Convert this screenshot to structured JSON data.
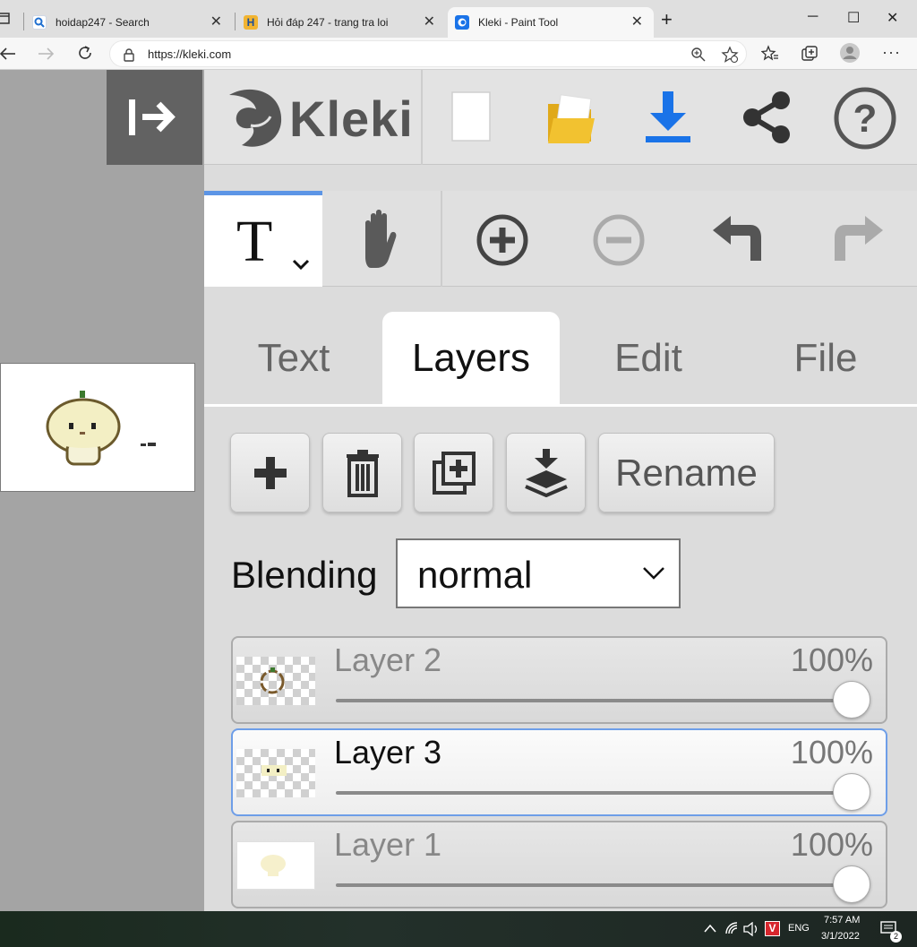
{
  "browser": {
    "tabs": [
      {
        "title": "hoidap247 - Search"
      },
      {
        "title": "Hỏi đáp 247 - trang tra loi"
      },
      {
        "title": "Kleki - Paint Tool"
      }
    ],
    "new_tab": "+",
    "window_controls": {
      "minimize": "─",
      "maximize": "☐",
      "close": "✕"
    },
    "url": "https://kleki.com"
  },
  "app": {
    "logo": "Kleki",
    "top_icons": [
      "new-image-icon",
      "open-folder-icon",
      "download-icon",
      "share-icon",
      "help-icon"
    ],
    "tools": {
      "text_glyph": "T",
      "icons": [
        "hand-icon",
        "zoom-in-icon",
        "zoom-out-icon",
        "undo-icon",
        "redo-icon"
      ]
    },
    "tabs": [
      "Text",
      "Layers",
      "Edit",
      "File"
    ],
    "active_tab": "Layers",
    "layer_actions": {
      "rename_label": "Rename"
    },
    "blending": {
      "label": "Blending",
      "value": "normal"
    },
    "layers": [
      {
        "name": "Layer 2",
        "opacity": "100%"
      },
      {
        "name": "Layer 3",
        "opacity": "100%",
        "selected": true
      },
      {
        "name": "Layer 1",
        "opacity": "100%"
      }
    ],
    "accent_color": "#5c95e6",
    "download_color": "#1a73e8",
    "folder_color": "#f2c230"
  },
  "taskbar": {
    "lang": "ENG",
    "time": "7:57 AM",
    "date": "3/1/2022",
    "notifications": "2"
  }
}
